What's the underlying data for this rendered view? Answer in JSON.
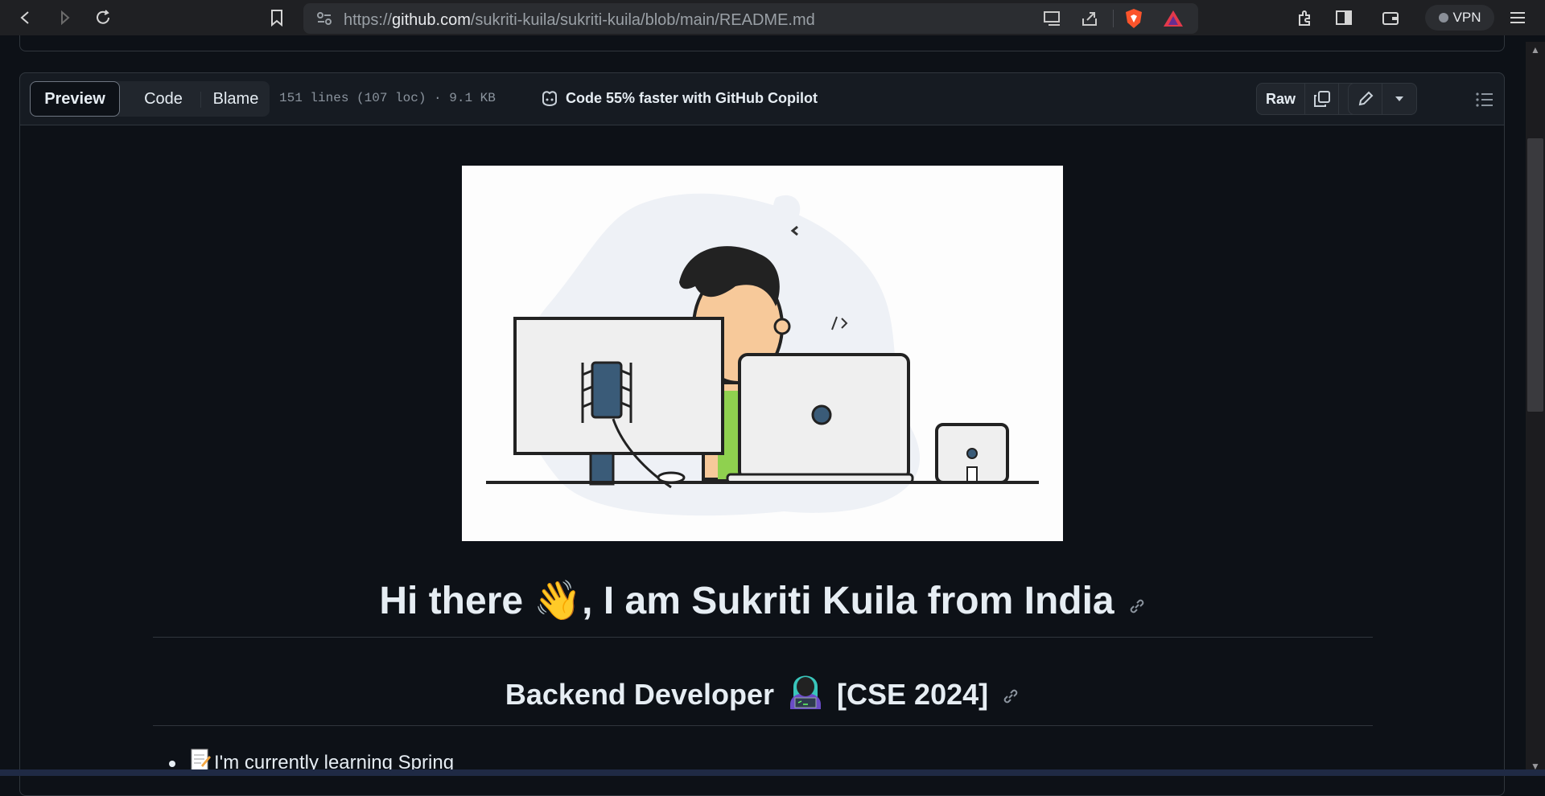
{
  "browser": {
    "url_prefix": "https://",
    "url_domain": "github.com",
    "url_path": "/sukriti-kuila/sukriti-kuila/blob/main/README.md",
    "vpn_label": "VPN"
  },
  "file_header": {
    "tabs": [
      "Preview",
      "Code",
      "Blame"
    ],
    "meta": "151 lines (107 loc) · 9.1 KB",
    "copilot_text": "Code 55% faster with GitHub Copilot",
    "raw_label": "Raw"
  },
  "readme": {
    "heading": "Hi there 👋, I am Sukriti Kuila from India",
    "subheading_prefix": "Backend Developer",
    "subheading_suffix": "[CSE 2024]",
    "list_item_1": "I'm currently learning Spring"
  },
  "colors": {
    "page_bg": "#0d1117",
    "header_bg": "#161b22",
    "border": "#30363d",
    "text": "#e6edf3",
    "muted": "#8b949e"
  }
}
